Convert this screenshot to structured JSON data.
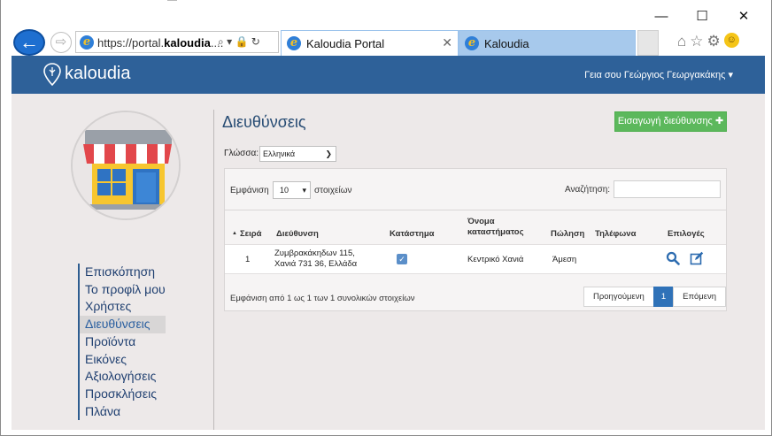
{
  "browser": {
    "title_partial": "—",
    "address": {
      "prefix": "https://portal.",
      "domain": "kaloudia",
      "suffix": "...."
    },
    "tabs": [
      {
        "label": "Kaloudia Portal",
        "active": true
      },
      {
        "label": "Kaloudia",
        "active": false
      }
    ]
  },
  "header": {
    "logo": "kaloudia",
    "user_greeting": "Γεια σου Γεώργιος Γεωργακάκης"
  },
  "sidebar": {
    "items": [
      {
        "label": "Επισκόπηση"
      },
      {
        "label": "Το προφίλ μου"
      },
      {
        "label": "Χρήστες"
      },
      {
        "label": "Διευθύνσεις",
        "active": true
      },
      {
        "label": "Προϊόντα"
      },
      {
        "label": "Εικόνες"
      },
      {
        "label": "Αξιολογήσεις"
      },
      {
        "label": "Προσκλήσεις"
      },
      {
        "label": "Πλάνα"
      }
    ]
  },
  "main": {
    "title": "Διευθύνσεις",
    "add_button": "Εισαγωγή διεύθυνσης",
    "language": {
      "label": "Γλώσσα:",
      "value": "Ελληνικά"
    },
    "table_controls": {
      "show_label": "Εμφάνιση",
      "length_value": "10",
      "entries_label": "στοιχείων",
      "search_label": "Αναζήτηση:",
      "search_value": ""
    },
    "columns": [
      "Σειρά",
      "Διεύθυνση",
      "Κατάστημα",
      "Όνομα καταστήματος",
      "Πώληση",
      "Τηλέφωνα",
      "Επιλογές"
    ],
    "rows": [
      {
        "order": "1",
        "address_line1": "Ζυμβρακάκηδων 115,",
        "address_line2": "Χανιά 731 36, Ελλάδα",
        "is_store": true,
        "store_name": "Κεντρικό Χανιά",
        "sale": "Άμεση",
        "phones": ""
      }
    ],
    "info": "Εμφάνιση από 1 ως 1 των 1 συνολικών στοιχείων",
    "pagination": {
      "prev": "Προηγούμενη",
      "current": "1",
      "next": "Επόμενη"
    }
  },
  "colors": {
    "header_bg": "#2e6199",
    "add_button": "#5cb85c",
    "accent": "#2f72b8"
  }
}
